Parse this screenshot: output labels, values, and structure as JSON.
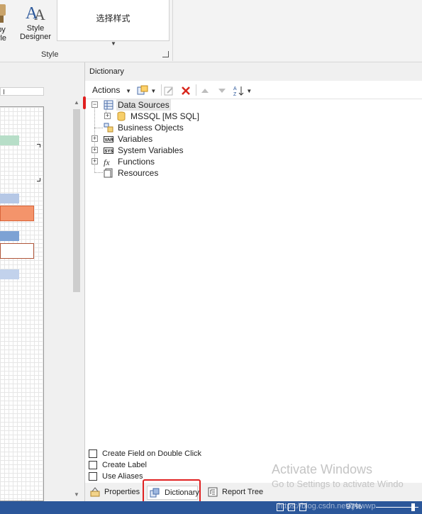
{
  "ribbon": {
    "copy_style_label": "py\nyle",
    "copy_style_line1": "py",
    "copy_style_line2": "yle",
    "style_designer_line1": "Style",
    "style_designer_line2": "Designer",
    "style_selector_text": "选择样式",
    "group_label": "Style"
  },
  "dictionary": {
    "title": "Dictionary",
    "toolbar": {
      "actions_label": "Actions",
      "icons": [
        "new-item-icon",
        "edit-icon",
        "delete-icon",
        "move-up-icon",
        "move-down-icon",
        "sort-az-icon"
      ]
    },
    "tree": [
      {
        "label": "Data Sources",
        "icon": "data-sources-icon",
        "expanded": true,
        "selected": true
      },
      {
        "label": "MSSQL [MS SQL]",
        "icon": "database-icon",
        "expanded": false
      },
      {
        "label": "Business Objects",
        "icon": "business-objects-icon"
      },
      {
        "label": "Variables",
        "icon": "variables-icon",
        "expanded": false
      },
      {
        "label": "System Variables",
        "icon": "system-variables-icon",
        "expanded": false
      },
      {
        "label": "Functions",
        "icon": "functions-icon",
        "expanded": false
      },
      {
        "label": "Resources",
        "icon": "resources-icon"
      }
    ],
    "options": [
      {
        "label": "Create Field on Double Click",
        "checked": false
      },
      {
        "label": "Create Label",
        "checked": false
      },
      {
        "label": "Use Aliases",
        "checked": false
      }
    ],
    "tabs": [
      {
        "label": "Properties",
        "active": false
      },
      {
        "label": "Dictionary",
        "active": true
      },
      {
        "label": "Report Tree",
        "active": false
      }
    ]
  },
  "watermark": {
    "title": "Activate Windows",
    "subtitle": "Go to Settings to activate Windo"
  },
  "statusbar": {
    "zoom": "97%",
    "url_overlay": "https://blog.csdn.net/lybwwp"
  },
  "colors": {
    "accent": "#2b579a",
    "highlight_red": "#e02020",
    "band_orange": "#f4946b",
    "band_green": "#b7dec8",
    "band_blue": "#7da2d4"
  }
}
